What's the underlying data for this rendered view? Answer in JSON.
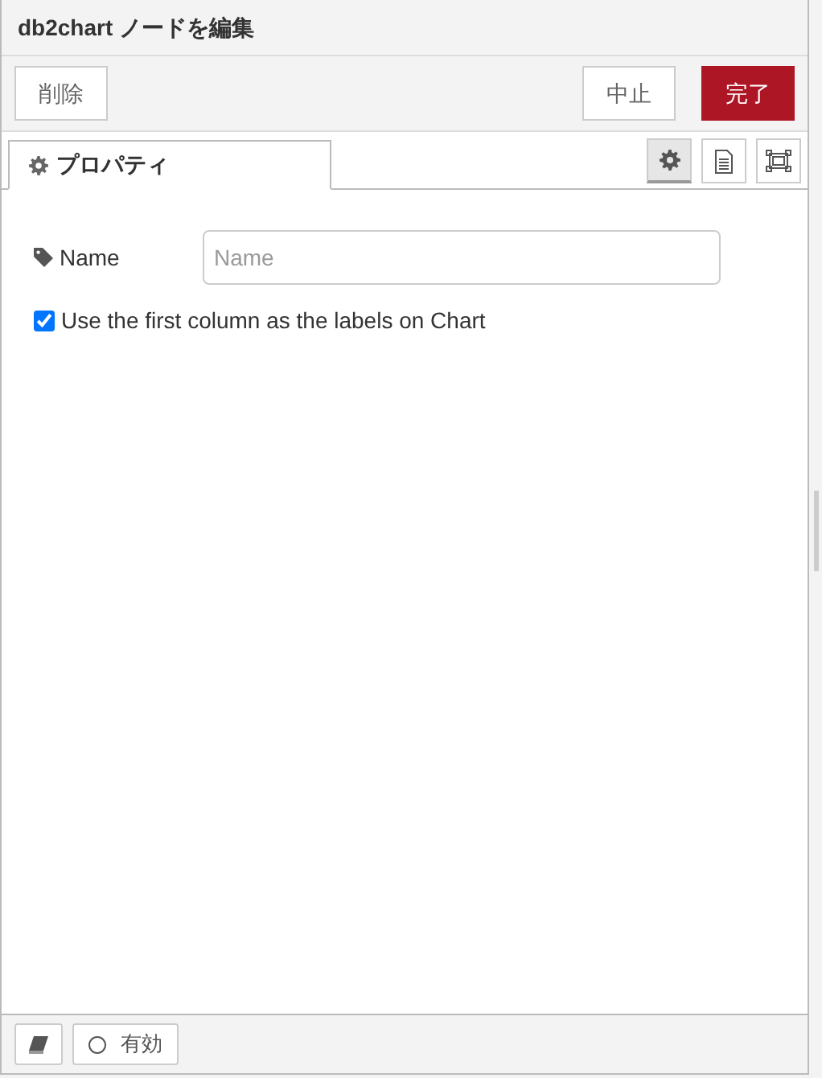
{
  "window": {
    "title": "db2chart ノードを編集"
  },
  "buttons": [
    {
      "label": "削除",
      "kind": "plain"
    },
    {
      "label": "中止",
      "kind": "plain"
    },
    {
      "label": "完了",
      "kind": "primary"
    }
  ],
  "tabs": [
    {
      "label": "プロパティ",
      "selected": true
    }
  ],
  "tab_icons": [
    {
      "kind": "gear",
      "selected": true
    },
    {
      "kind": "document",
      "selected": false
    },
    {
      "kind": "frame",
      "selected": false
    }
  ],
  "fields": [
    {
      "label": "Name",
      "placeholder": "Name"
    }
  ],
  "checkbox": {
    "label": "Use the first column as the labels on Chart",
    "checked": true
  },
  "footer": {
    "enabled": {
      "label": "有効",
      "on": false
    }
  }
}
